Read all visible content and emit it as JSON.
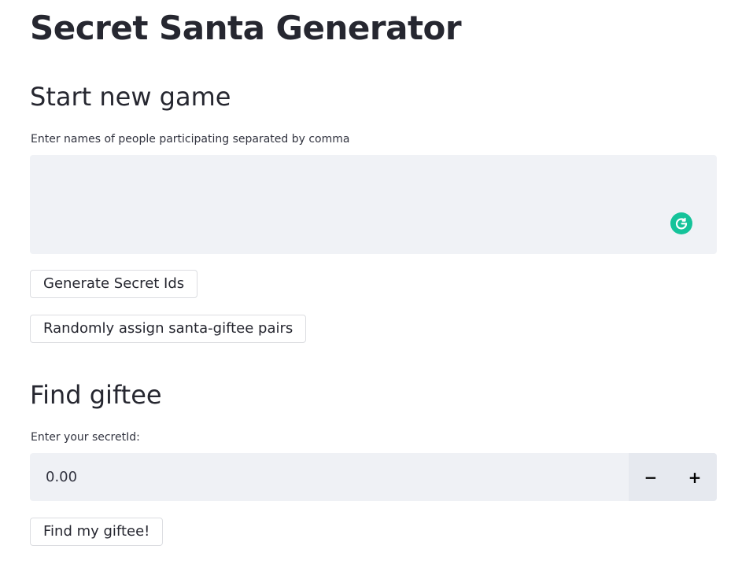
{
  "app": {
    "title": "Secret Santa Generator"
  },
  "start_section": {
    "heading": "Start new game",
    "names_label": "Enter names of people participating separated by comma",
    "names_value": "",
    "generate_button": "Generate Secret Ids",
    "assign_button": "Randomly assign santa-giftee pairs",
    "grammarly_icon": "grammarly-g-icon"
  },
  "find_section": {
    "heading": "Find giftee",
    "secret_label": "Enter your secretId:",
    "secret_value": "0.00",
    "minus_label": "−",
    "plus_label": "+",
    "find_button": "Find my giftee!"
  },
  "colors": {
    "input_bg": "#f0f2f6",
    "grammarly": "#15c39a",
    "text": "#262730"
  }
}
